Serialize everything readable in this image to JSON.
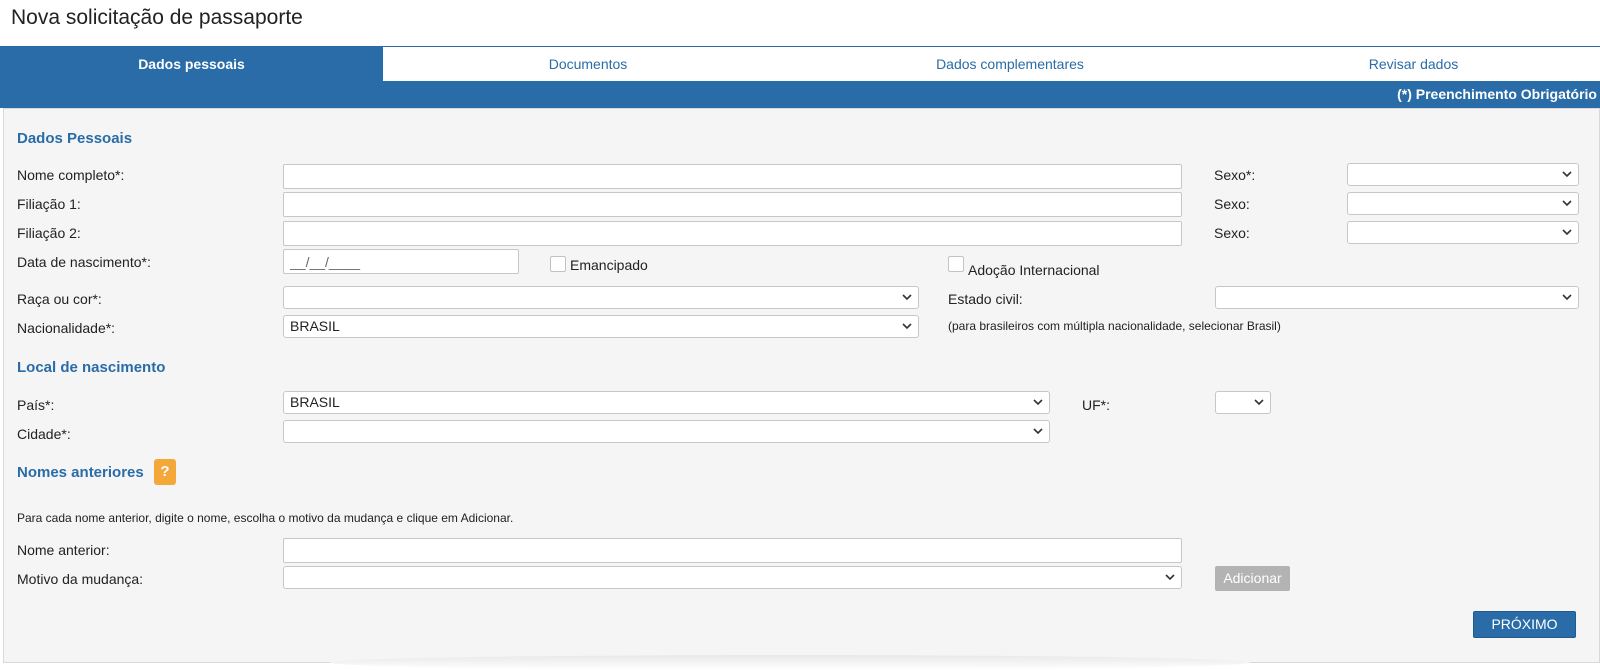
{
  "page": {
    "title": "Nova solicitação de passaporte"
  },
  "tabs": [
    {
      "label": "Dados pessoais",
      "active": true
    },
    {
      "label": "Documentos",
      "active": false
    },
    {
      "label": "Dados complementares",
      "active": false
    },
    {
      "label": "Revisar dados",
      "active": false
    }
  ],
  "required_note": "(*) Preenchimento Obrigatório",
  "dados_pessoais": {
    "title": "Dados Pessoais",
    "nome_completo": {
      "label": "Nome completo*:",
      "value": ""
    },
    "sexo1": {
      "label": "Sexo*:",
      "value": ""
    },
    "filiacao1": {
      "label": "Filiação 1:",
      "value": ""
    },
    "sexo2": {
      "label": "Sexo:",
      "value": ""
    },
    "filiacao2": {
      "label": "Filiação 2:",
      "value": ""
    },
    "sexo3": {
      "label": "Sexo:",
      "value": ""
    },
    "data_nascimento": {
      "label": "Data de nascimento*:",
      "value": "__/__/____"
    },
    "emancipado": {
      "label": "Emancipado",
      "checked": false
    },
    "adocao": {
      "label": "Adoção Internacional",
      "checked": false
    },
    "raca": {
      "label": "Raça ou cor*:",
      "value": ""
    },
    "estado_civil": {
      "label": "Estado civil:",
      "value": ""
    },
    "nacionalidade": {
      "label": "Nacionalidade*:",
      "value": "BRASIL"
    },
    "nacionalidade_hint": "(para brasileiros com múltipla nacionalidade, selecionar Brasil)"
  },
  "local_nascimento": {
    "title": "Local de nascimento",
    "pais": {
      "label": "País*:",
      "value": "BRASIL"
    },
    "uf": {
      "label": "UF*:",
      "value": ""
    },
    "cidade": {
      "label": "Cidade*:",
      "value": ""
    }
  },
  "nomes_anteriores": {
    "title": "Nomes anteriores",
    "help": "?",
    "instructions": "Para cada nome anterior, digite o nome, escolha o motivo da mudança e clique em Adicionar.",
    "nome_anterior": {
      "label": "Nome anterior:",
      "value": ""
    },
    "motivo": {
      "label": "Motivo da mudança:",
      "value": ""
    },
    "add_label": "Adicionar"
  },
  "next_label": "PRÓXIMO",
  "colors": {
    "primary": "#2a6ca8",
    "help": "#f4a83a",
    "disabled": "#b3b3b3"
  }
}
